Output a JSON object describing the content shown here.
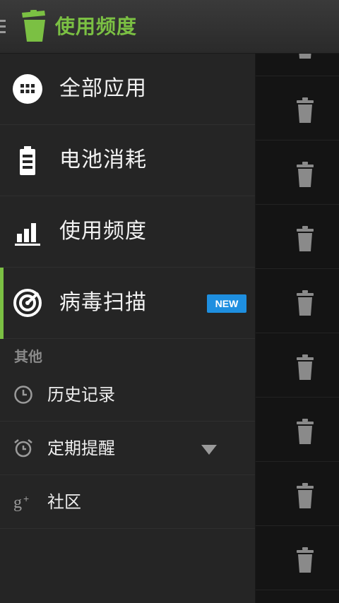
{
  "appbar": {
    "title": "使用频度",
    "logo_icon": "trash-can-logo-icon",
    "menu_icon": "hamburger-icon"
  },
  "drawer": {
    "items": [
      {
        "label": "全部应用",
        "icon": "grid-apps-icon",
        "active": false
      },
      {
        "label": "电池消耗",
        "icon": "battery-icon",
        "active": false
      },
      {
        "label": "使用频度",
        "icon": "bar-chart-icon",
        "active": false
      },
      {
        "label": "病毒扫描",
        "icon": "radar-scan-icon",
        "active": true,
        "badge": "NEW"
      }
    ],
    "section_header": "其他",
    "sub_items": [
      {
        "label": "历史记录",
        "icon": "clock-icon"
      },
      {
        "label": "定期提醒",
        "icon": "alarm-clock-icon",
        "expandable": true
      },
      {
        "label": "社区",
        "icon": "google-plus-icon"
      }
    ]
  },
  "colors": {
    "accent": "#7bc043",
    "badge": "#1e8fe0",
    "drawer_bg": "#252525",
    "appbar_bg": "#333333"
  }
}
